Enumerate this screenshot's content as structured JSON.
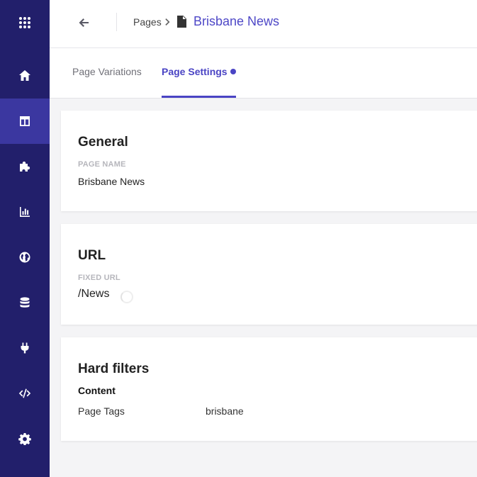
{
  "sidebar": {
    "items": [
      {
        "icon": "apps-grid-icon"
      },
      {
        "icon": "home-icon"
      },
      {
        "icon": "layout-icon",
        "active": true
      },
      {
        "icon": "puzzle-icon"
      },
      {
        "icon": "bar-chart-icon"
      },
      {
        "icon": "globe-icon"
      },
      {
        "icon": "database-icon"
      },
      {
        "icon": "plug-icon"
      },
      {
        "icon": "code-icon"
      },
      {
        "icon": "gear-icon"
      }
    ]
  },
  "header": {
    "breadcrumb_root": "Pages",
    "page_title": "Brisbane News"
  },
  "tabs": [
    {
      "label": "Page Variations",
      "active": false
    },
    {
      "label": "Page Settings",
      "active": true
    }
  ],
  "general": {
    "title": "General",
    "page_name_label": "PAGE NAME",
    "page_name_value": "Brisbane News"
  },
  "url": {
    "title": "URL",
    "fixed_url_label": "FIXED URL",
    "fixed_url_value": "/News"
  },
  "hard_filters": {
    "title": "Hard filters",
    "section": "Content",
    "rows": [
      {
        "label": "Page Tags",
        "value": "brisbane"
      }
    ]
  },
  "colors": {
    "sidebar_bg": "#221f6b",
    "sidebar_active": "#3b37a0",
    "accent": "#4a44c4"
  }
}
